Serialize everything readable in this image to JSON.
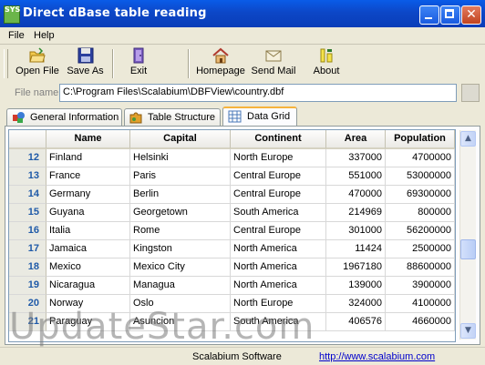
{
  "window": {
    "title": "Direct dBase table reading",
    "icon_text": "SYS"
  },
  "menu": [
    {
      "label": "File"
    },
    {
      "label": "Help"
    }
  ],
  "toolbar": [
    {
      "label": "Open File",
      "icon": "open-folder-icon"
    },
    {
      "label": "Save As",
      "icon": "floppy-disk-icon"
    },
    {
      "label": "Exit",
      "icon": "exit-door-icon"
    },
    {
      "label": "Homepage",
      "icon": "home-icon"
    },
    {
      "label": "Send Mail",
      "icon": "envelope-icon"
    },
    {
      "label": "About",
      "icon": "about-icon"
    }
  ],
  "file": {
    "label": "File name:",
    "value": "C:\\Program Files\\Scalabium\\DBFView\\country.dbf"
  },
  "tabs": [
    {
      "label": "General Information",
      "icon": "shapes-icon",
      "active": false
    },
    {
      "label": "Table Structure",
      "icon": "puzzle-icon",
      "active": false
    },
    {
      "label": "Data Grid",
      "icon": "grid-icon",
      "active": true
    }
  ],
  "grid": {
    "columns": [
      "Name",
      "Capital",
      "Continent",
      "Area",
      "Population"
    ],
    "rows": [
      {
        "index": "12",
        "cells": [
          "Finland",
          "Helsinki",
          "North Europe",
          "337000",
          "4700000"
        ]
      },
      {
        "index": "13",
        "cells": [
          "France",
          "Paris",
          "Central Europe",
          "551000",
          "53000000"
        ]
      },
      {
        "index": "14",
        "cells": [
          "Germany",
          "Berlin",
          "Central Europe",
          "470000",
          "69300000"
        ]
      },
      {
        "index": "15",
        "cells": [
          "Guyana",
          "Georgetown",
          "South America",
          "214969",
          "800000"
        ]
      },
      {
        "index": "16",
        "cells": [
          "Italia",
          "Rome",
          "Central Europe",
          "301000",
          "56200000"
        ]
      },
      {
        "index": "17",
        "cells": [
          "Jamaica",
          "Kingston",
          "North America",
          "11424",
          "2500000"
        ]
      },
      {
        "index": "18",
        "cells": [
          "Mexico",
          "Mexico City",
          "North America",
          "1967180",
          "88600000"
        ]
      },
      {
        "index": "19",
        "cells": [
          "Nicaragua",
          "Managua",
          "North America",
          "139000",
          "3900000"
        ]
      },
      {
        "index": "20",
        "cells": [
          "Norway",
          "Oslo",
          "North Europe",
          "324000",
          "4100000"
        ]
      },
      {
        "index": "21",
        "cells": [
          "Paraguay",
          "Asuncion",
          "South America",
          "406576",
          "4660000"
        ]
      }
    ]
  },
  "status": {
    "company": "Scalabium Software",
    "url": "http://www.scalabium.com"
  },
  "watermark": "UpdateStar.com",
  "colors": {
    "titlebar": "#0a5ce8",
    "active_tab_accent": "#f6b33c",
    "row_index": "#1f5aa8",
    "link": "#0000cc"
  }
}
